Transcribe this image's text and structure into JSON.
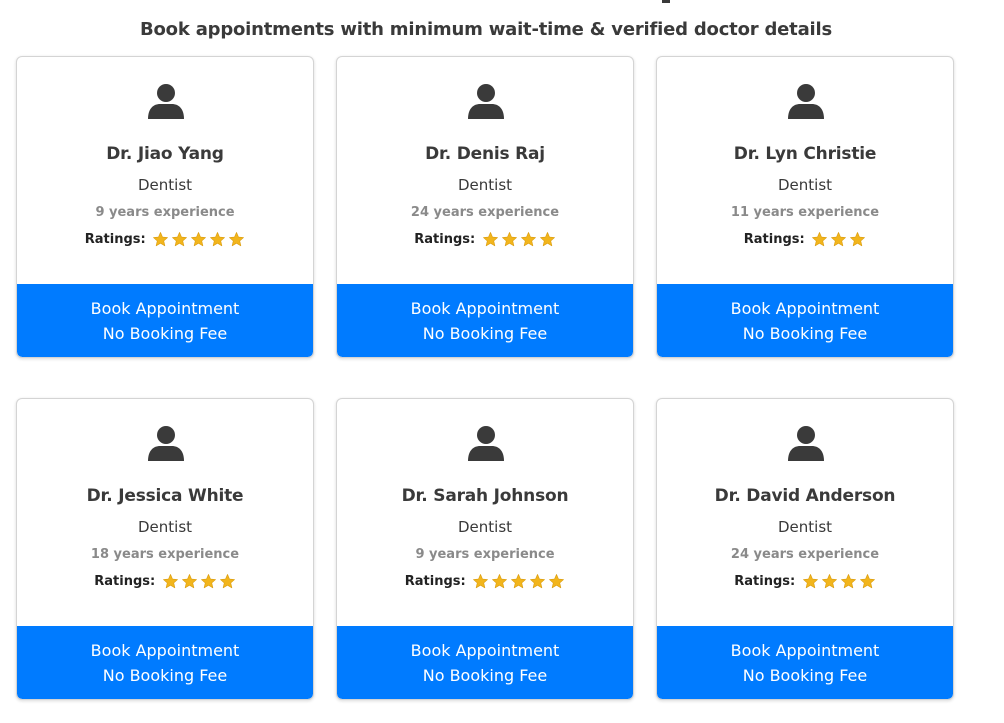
{
  "header": {
    "subtitle": "Book appointments with minimum wait-time & verified doctor details"
  },
  "colors": {
    "accent": "#007bff",
    "star": "#f2b51c",
    "text": "#3a3a3a",
    "muted": "#8a8a8a"
  },
  "doctors": [
    {
      "name": "Dr. Jiao Yang",
      "specialty": "Dentist",
      "experience": "9 years experience",
      "ratings_label": "Ratings:",
      "stars": 5,
      "book_label": "Book Appointment",
      "fee_label": "No Booking Fee"
    },
    {
      "name": "Dr. Denis Raj",
      "specialty": "Dentist",
      "experience": "24 years experience",
      "ratings_label": "Ratings:",
      "stars": 4,
      "book_label": "Book Appointment",
      "fee_label": "No Booking Fee"
    },
    {
      "name": "Dr. Lyn Christie",
      "specialty": "Dentist",
      "experience": "11 years experience",
      "ratings_label": "Ratings:",
      "stars": 3,
      "book_label": "Book Appointment",
      "fee_label": "No Booking Fee"
    },
    {
      "name": "Dr. Jessica White",
      "specialty": "Dentist",
      "experience": "18 years experience",
      "ratings_label": "Ratings:",
      "stars": 4,
      "book_label": "Book Appointment",
      "fee_label": "No Booking Fee"
    },
    {
      "name": "Dr. Sarah Johnson",
      "specialty": "Dentist",
      "experience": "9 years experience",
      "ratings_label": "Ratings:",
      "stars": 5,
      "book_label": "Book Appointment",
      "fee_label": "No Booking Fee"
    },
    {
      "name": "Dr. David Anderson",
      "specialty": "Dentist",
      "experience": "24 years experience",
      "ratings_label": "Ratings:",
      "stars": 4,
      "book_label": "Book Appointment",
      "fee_label": "No Booking Fee"
    }
  ]
}
